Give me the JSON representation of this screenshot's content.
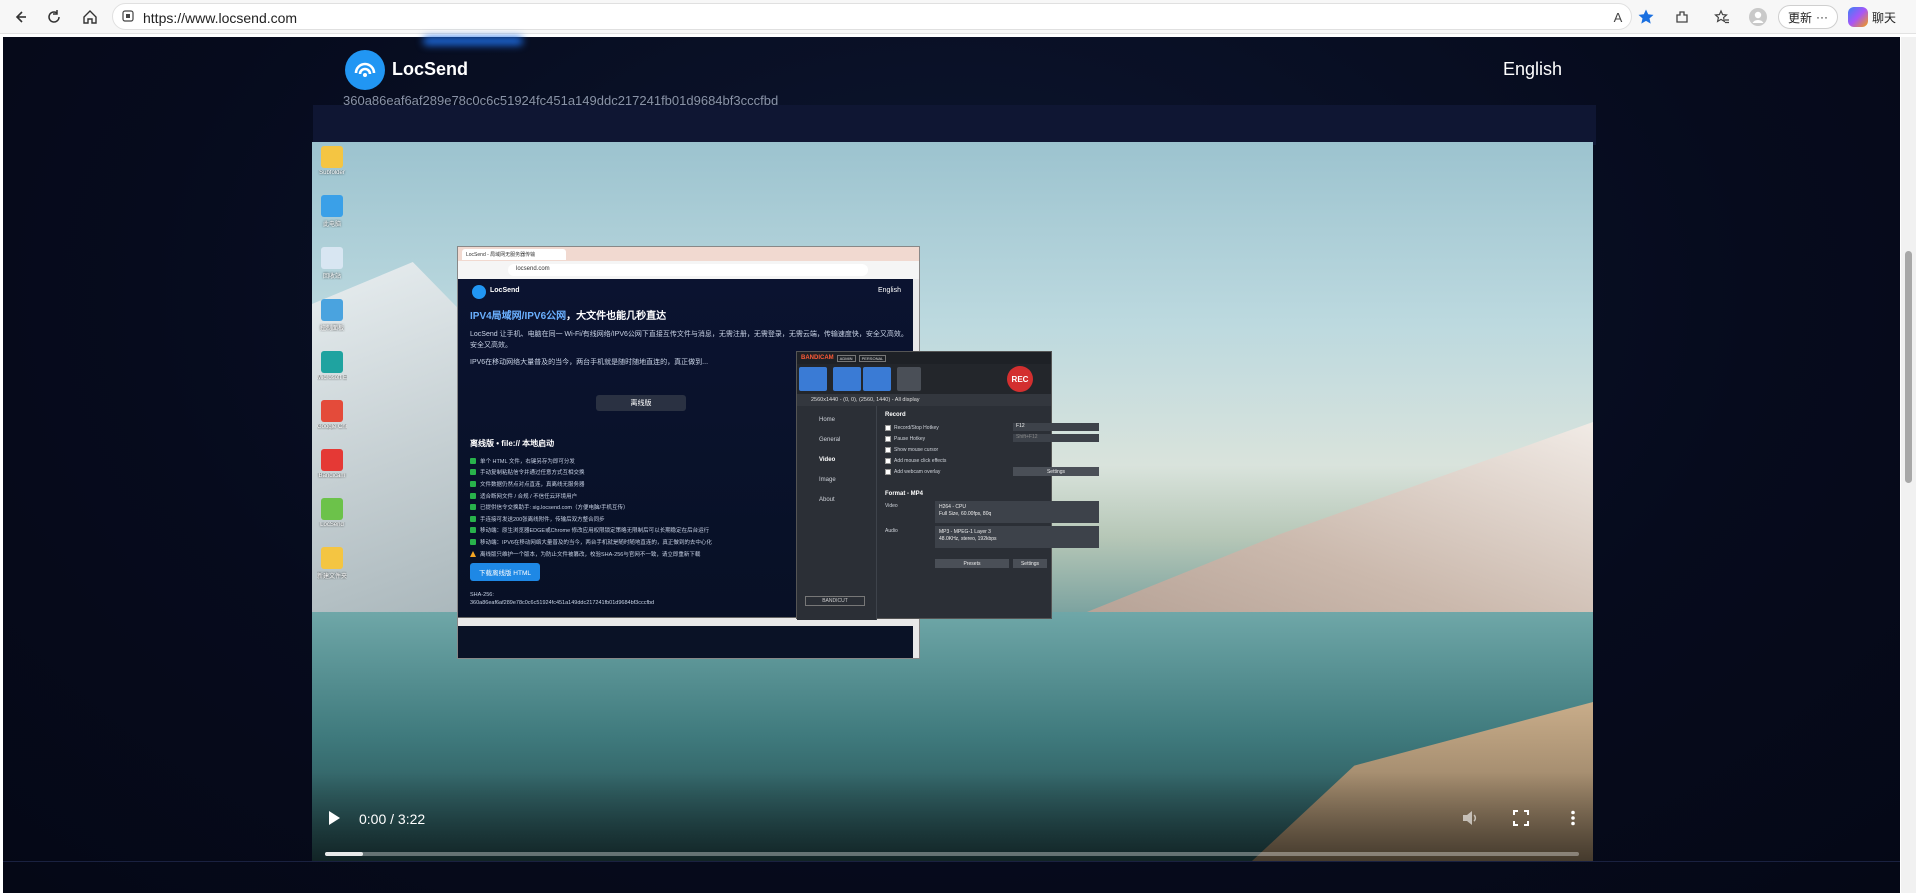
{
  "browser": {
    "url": "https://www.locsend.com",
    "read_aloud_label": "A",
    "update_label": "更新",
    "more_label": "···",
    "chat_label": "聊天"
  },
  "site": {
    "logo_text": "LocSend",
    "language": "English",
    "hash_fragment": "360a86eaf6af289e78c0c6c51924fc451a149ddc217241fb01d9684bf3cccfbd"
  },
  "desktop": {
    "icons": [
      {
        "label": "Subfolder",
        "color": "#f4c542"
      },
      {
        "label": "此电脑",
        "color": "#3aa0e8"
      },
      {
        "label": "回收站",
        "color": "#d8e6f2"
      },
      {
        "label": "控制面板",
        "color": "#4aa3df"
      },
      {
        "label": "Microsoft Edge",
        "color": "#1fa3a0"
      },
      {
        "label": "Google Chrome",
        "color": "#e44b3a"
      },
      {
        "label": "Bandicam",
        "color": "#e53935"
      },
      {
        "label": "LocSend",
        "color": "#6cc24a"
      },
      {
        "label": "新建文件夹",
        "color": "#f4c542"
      }
    ]
  },
  "inner_browser": {
    "tab_title": "LocSend - 局域网无服务器传输",
    "url": "locsend.com",
    "logo_text": "LocSend",
    "language": "English",
    "headline_highlight": "IPV4局域网/IPV6公网",
    "headline_rest": "，大文件也能几秒直达",
    "para1": "LocSend 让手机、电脑在同一 Wi-Fi/有线网络/IPV6公网下直接互传文件与消息，无需注册，无需登录，无需云端，传输速度快，安全又高效。",
    "para1b": "安全又高效。",
    "para2": "IPV6在移动网络大量普及的当今，两台手机就是随时随地直连的，真正做到...",
    "tab_label": "离线版",
    "section_title": "离线版 • file:// 本地启动",
    "features": [
      "单个 HTML 文件，右键另存为即可分发",
      "手动复制粘贴信令并通过任意方式互相交换",
      "文件数据仍然点对点直连，真离线无服务器",
      "适合断网文件 / 合规 / 不信任云环境用户",
      "已提供信令交换助手: sig.locsend.com（方便电脑/手机互传）",
      "手连接可发送200张离线附件，传输后双方整合同步",
      "移动端：原生浏览器EDGE或Chrome 修改应用权限锁定策略无限制后可以长期稳定在后台运行",
      "移动端：IPV6在移动网络大量普及的当今，两台手机就是随时随地直连的，真正做到的去中心化"
    ],
    "warning": "离线版只维护一个版本，为防止文件被篡改，校验SHA-256与官网不一致，请立即重新下载",
    "download_label": "下载离线版 HTML",
    "sha_label": "SHA-256:",
    "sha_value": "360a86eaf6af289e78c0c6c51924fc451a149ddc217241fb01d9684bf3cccfbd"
  },
  "bandicam": {
    "brand_a": "BANDI",
    "brand_b": "CAM",
    "pill1": "ADMIN",
    "pill2": "PERSONAL",
    "rec_label": "REC",
    "display_info": "2560x1440 - (0, 0), (2560, 1440) - All display",
    "nav": [
      "Home",
      "General",
      "Video",
      "Image",
      "About"
    ],
    "active_nav": "Video",
    "record_title": "Record",
    "record_hotkey_label": "Record/Stop Hotkey",
    "record_hotkey_value": "F12",
    "pause_hotkey_label": "Pause Hotkey",
    "pause_hotkey_value": "Shift+F12",
    "show_cursor_label": "Show mouse cursor",
    "click_effects_label": "Add mouse click effects",
    "webcam_label": "Add webcam overlay",
    "settings_label": "Settings",
    "format_title": "Format - MP4",
    "video_label": "Video",
    "video_line1": "H264 - CPU",
    "video_line2": "Full Size, 60.00fps, 80q",
    "audio_label": "Audio",
    "audio_line1": "MP3 - MPEG-1 Layer 3",
    "audio_line2": "48.0KHz, stereo, 192kbps",
    "presets_label": "Presets",
    "settings2_label": "Settings",
    "bandicut_label": "BANDICUT"
  },
  "video_player": {
    "time": "0:00 / 3:22",
    "progress": 0.03
  }
}
